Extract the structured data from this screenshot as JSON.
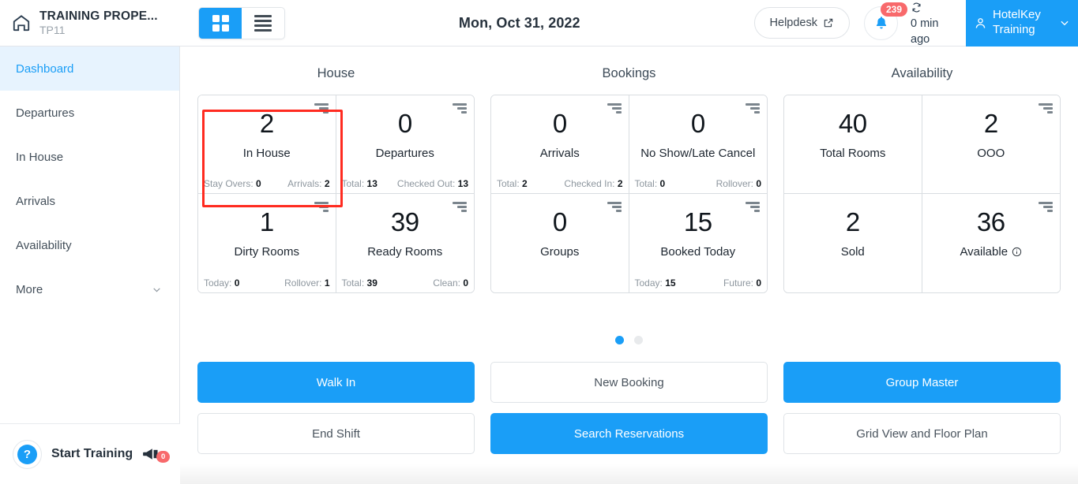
{
  "header": {
    "home_icon": "home-icon",
    "property_name": "TRAINING PROPE...",
    "property_code": "TP11",
    "view_toggle": {
      "grid_label": "grid-view",
      "list_label": "list-view",
      "active": "grid"
    },
    "date": "Mon, Oct 31, 2022",
    "helpdesk_label": "Helpdesk",
    "helpdesk_icon": "external-link-icon",
    "notification_icon": "bell-icon",
    "notification_count": "239",
    "sync_icon": "refresh-icon",
    "sync_text": "0 min ago",
    "user_icon": "user-icon",
    "user_name": "HotelKey Training",
    "user_chevron": "chevron-down-icon"
  },
  "sidebar": {
    "items": [
      {
        "label": "Dashboard",
        "active": true
      },
      {
        "label": "Departures",
        "active": false
      },
      {
        "label": "In House",
        "active": false
      },
      {
        "label": "Arrivals",
        "active": false
      },
      {
        "label": "Availability",
        "active": false
      },
      {
        "label": "More",
        "active": false,
        "chevron": "chevron-down-icon"
      }
    ],
    "training": {
      "help_icon": "question-mark-icon",
      "help_glyph": "?",
      "label": "Start Training",
      "megaphone_icon": "megaphone-icon",
      "megaphone_badge": "0"
    }
  },
  "main": {
    "columns": [
      {
        "title": "House",
        "cards": [
          {
            "value": "2",
            "label": "In House",
            "left_label": "Stay Overs:",
            "left_value": "0",
            "right_label": "Arrivals:",
            "right_value": "2",
            "sort_icon": "sort-descending-icon",
            "highlighted": true
          },
          {
            "value": "0",
            "label": "Departures",
            "left_label": "Total:",
            "left_value": "13",
            "right_label": "Checked Out:",
            "right_value": "13",
            "sort_icon": "sort-descending-icon"
          },
          {
            "value": "1",
            "label": "Dirty Rooms",
            "left_label": "Today:",
            "left_value": "0",
            "right_label": "Rollover:",
            "right_value": "1",
            "sort_icon": "sort-descending-icon"
          },
          {
            "value": "39",
            "label": "Ready Rooms",
            "left_label": "Total:",
            "left_value": "39",
            "right_label": "Clean:",
            "right_value": "0",
            "sort_icon": "sort-descending-icon"
          }
        ]
      },
      {
        "title": "Bookings",
        "cards": [
          {
            "value": "0",
            "label": "Arrivals",
            "left_label": "Total:",
            "left_value": "2",
            "right_label": "Checked In:",
            "right_value": "2",
            "sort_icon": "sort-descending-icon"
          },
          {
            "value": "0",
            "label": "No Show/Late Cancel",
            "left_label": "Total:",
            "left_value": "0",
            "right_label": "Rollover:",
            "right_value": "0",
            "sort_icon": "sort-descending-icon"
          },
          {
            "value": "0",
            "label": "Groups",
            "sort_icon": "sort-descending-icon"
          },
          {
            "value": "15",
            "label": "Booked Today",
            "left_label": "Today:",
            "left_value": "15",
            "right_label": "Future:",
            "right_value": "0",
            "sort_icon": "sort-descending-icon"
          }
        ]
      },
      {
        "title": "Availability",
        "cards": [
          {
            "value": "40",
            "label": "Total Rooms"
          },
          {
            "value": "2",
            "label": "OOO",
            "sort_icon": "sort-descending-icon"
          },
          {
            "value": "2",
            "label": "Sold"
          },
          {
            "value": "36",
            "label": "Available",
            "info_icon": "info-icon",
            "sort_icon": "sort-descending-icon"
          }
        ]
      }
    ],
    "pagination": {
      "total": 2,
      "active_index": 0
    },
    "actions": [
      [
        {
          "label": "Walk In",
          "style": "primary"
        },
        {
          "label": "New Booking",
          "style": "default"
        },
        {
          "label": "Group Master",
          "style": "primary"
        }
      ],
      [
        {
          "label": "End Shift",
          "style": "default"
        },
        {
          "label": "Search Reservations",
          "style": "primary"
        },
        {
          "label": "Grid View and Floor Plan",
          "style": "default"
        }
      ]
    ]
  },
  "colors": {
    "accent": "#1a9ef7",
    "badge_red": "#f8696b",
    "highlight_red": "#ff2b20",
    "sidebar_active_bg": "#e7f3fe",
    "text_dark": "#27323d",
    "text_muted": "#8e979f"
  }
}
